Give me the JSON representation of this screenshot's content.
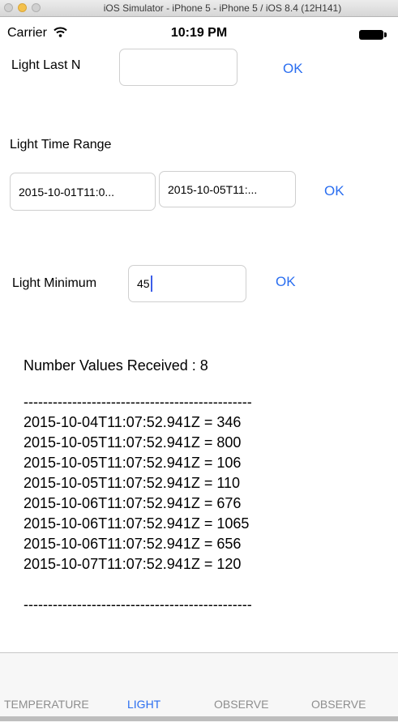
{
  "window": {
    "title": "iOS Simulator - iPhone 5 - iPhone 5 / iOS 8.4 (12H141)"
  },
  "statusbar": {
    "carrier": "Carrier",
    "time": "10:19 PM"
  },
  "last_n": {
    "label": "Light Last N",
    "value": "",
    "ok": "OK"
  },
  "time_range": {
    "label": "Light Time Range",
    "start": "2015-10-01T11:0...",
    "end": "2015-10-05T11:...",
    "ok": "OK"
  },
  "minimum": {
    "label": "Light Minimum",
    "value": "45",
    "ok": "OK"
  },
  "results": {
    "count_line": "Number Values Received : 8",
    "separator": "-----------------------------------------------",
    "rows": [
      "2015-10-04T11:07:52.941Z = 346",
      "2015-10-05T11:07:52.941Z = 800",
      "2015-10-05T11:07:52.941Z = 106",
      "2015-10-05T11:07:52.941Z = 110",
      "2015-10-06T11:07:52.941Z = 676",
      "2015-10-06T11:07:52.941Z = 1065",
      "2015-10-06T11:07:52.941Z = 656",
      "2015-10-07T11:07:52.941Z = 120"
    ]
  },
  "tabs": [
    {
      "label": "TEMPERATURE",
      "active": false
    },
    {
      "label": "LIGHT",
      "active": true
    },
    {
      "label": "OBSERVE",
      "active": false
    },
    {
      "label": "OBSERVE",
      "active": false
    }
  ],
  "icons": {
    "wifi": "wifi-icon",
    "battery": "battery-icon"
  },
  "colors": {
    "accent": "#2a6ef0",
    "caret": "#3c5de8"
  }
}
